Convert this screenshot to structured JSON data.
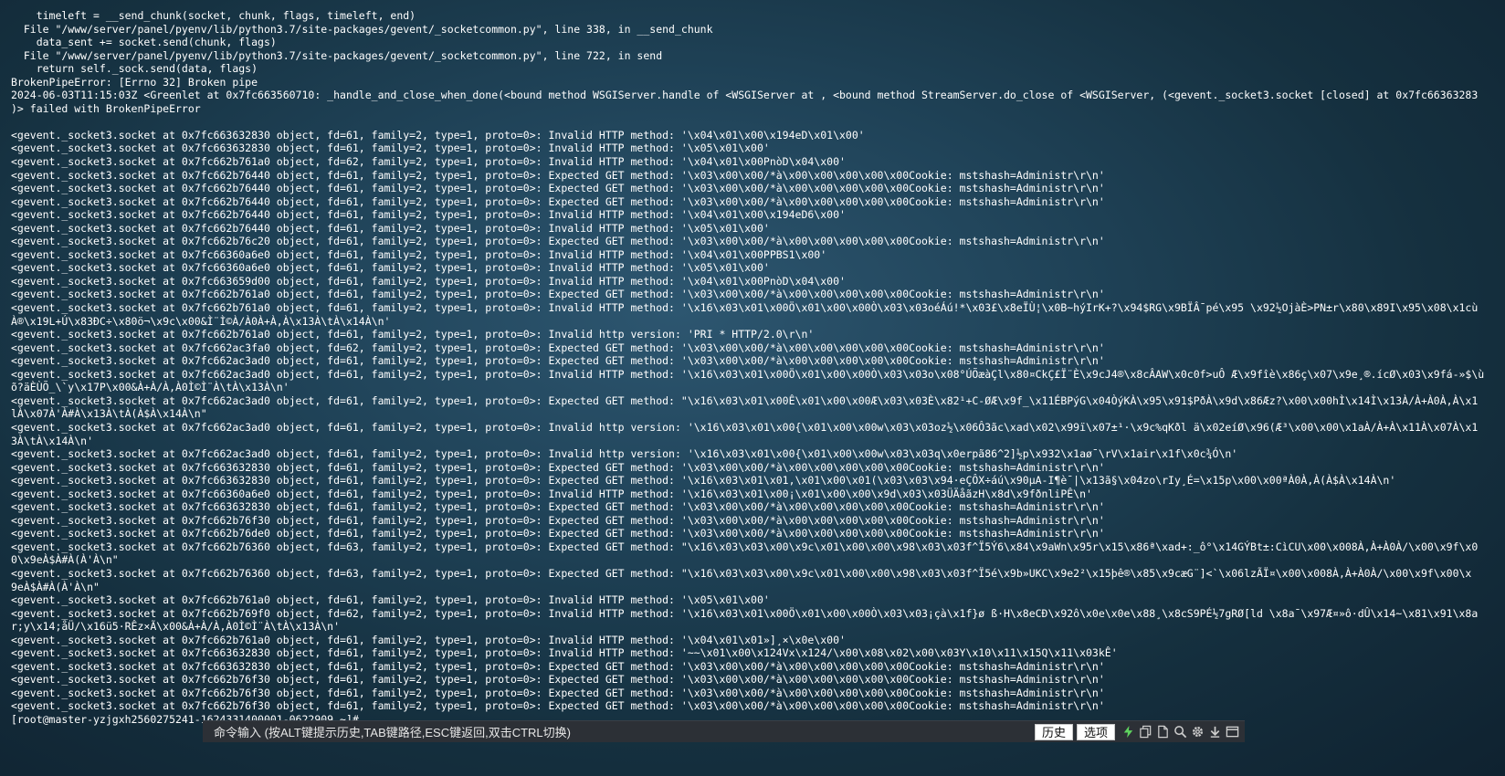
{
  "terminal": {
    "lines": [
      "    timeleft = __send_chunk(socket, chunk, flags, timeleft, end)",
      "  File \"/www/server/panel/pyenv/lib/python3.7/site-packages/gevent/_socketcommon.py\", line 338, in __send_chunk",
      "    data_sent += socket.send(chunk, flags)",
      "  File \"/www/server/panel/pyenv/lib/python3.7/site-packages/gevent/_socketcommon.py\", line 722, in send",
      "    return self._sock.send(data, flags)",
      "BrokenPipeError: [Errno 32] Broken pipe",
      "2024-06-03T11:15:03Z <Greenlet at 0x7fc663560710: _handle_and_close_when_done(<bound method WSGIServer.handle of <WSGIServer at , <bound method StreamServer.do_close of <WSGIServer, (<gevent._socket3.socket [closed] at 0x7fc66363283",
      ")> failed with BrokenPipeError",
      "",
      "<gevent._socket3.socket at 0x7fc663632830 object, fd=61, family=2, type=1, proto=0>: Invalid HTTP method: '\\x04\\x01\\x00\\x194eD\\x01\\x00'",
      "<gevent._socket3.socket at 0x7fc663632830 object, fd=61, family=2, type=1, proto=0>: Invalid HTTP method: '\\x05\\x01\\x00'",
      "<gevent._socket3.socket at 0x7fc662b761a0 object, fd=62, family=2, type=1, proto=0>: Invalid HTTP method: '\\x04\\x01\\x00PnòD\\x04\\x00'",
      "<gevent._socket3.socket at 0x7fc662b76440 object, fd=61, family=2, type=1, proto=0>: Expected GET method: '\\x03\\x00\\x00/*à\\x00\\x00\\x00\\x00\\x00Cookie: mstshash=Administr\\r\\n'",
      "<gevent._socket3.socket at 0x7fc662b76440 object, fd=61, family=2, type=1, proto=0>: Expected GET method: '\\x03\\x00\\x00/*à\\x00\\x00\\x00\\x00\\x00Cookie: mstshash=Administr\\r\\n'",
      "<gevent._socket3.socket at 0x7fc662b76440 object, fd=61, family=2, type=1, proto=0>: Expected GET method: '\\x03\\x00\\x00/*à\\x00\\x00\\x00\\x00\\x00Cookie: mstshash=Administr\\r\\n'",
      "<gevent._socket3.socket at 0x7fc662b76440 object, fd=61, family=2, type=1, proto=0>: Invalid HTTP method: '\\x04\\x01\\x00\\x194eD6\\x00'",
      "<gevent._socket3.socket at 0x7fc662b76440 object, fd=61, family=2, type=1, proto=0>: Invalid HTTP method: '\\x05\\x01\\x00'",
      "<gevent._socket3.socket at 0x7fc662b76c20 object, fd=61, family=2, type=1, proto=0>: Expected GET method: '\\x03\\x00\\x00/*à\\x00\\x00\\x00\\x00\\x00Cookie: mstshash=Administr\\r\\n'",
      "<gevent._socket3.socket at 0x7fc66360a6e0 object, fd=61, family=2, type=1, proto=0>: Invalid HTTP method: '\\x04\\x01\\x00PPBS1\\x00'",
      "<gevent._socket3.socket at 0x7fc66360a6e0 object, fd=61, family=2, type=1, proto=0>: Invalid HTTP method: '\\x05\\x01\\x00'",
      "<gevent._socket3.socket at 0x7fc663659d00 object, fd=61, family=2, type=1, proto=0>: Invalid HTTP method: '\\x04\\x01\\x00PnòD\\x04\\x00'",
      "<gevent._socket3.socket at 0x7fc662b761a0 object, fd=61, family=2, type=1, proto=0>: Expected GET method: '\\x03\\x00\\x00/*à\\x00\\x00\\x00\\x00\\x00Cookie: mstshash=Administr\\r\\n'",
      "<gevent._socket3.socket at 0x7fc662b761a0 object, fd=61, family=2, type=1, proto=0>: Invalid HTTP method: '\\x16\\x03\\x01\\x00Ö\\x01\\x00\\x00Ò\\x03\\x03oéÁú!*\\x03£\\x8eÏÙ¦\\x0B~hýIrK+?\\x94$RG\\x9BÏÂ¯pé\\x95 \\x92½OjàÈ>PN±r\\x80\\x89I\\x95\\x08\\x1cù",
      "À®\\x19L+Ú\\x83ÐC÷\\x80ö¬\\x9c\\x00&Ì¨Ì©À/À0À+À,À\\x13À\\tÀ\\x14À\\n'",
      "<gevent._socket3.socket at 0x7fc662b761a0 object, fd=61, family=2, type=1, proto=0>: Invalid http version: 'PRI * HTTP/2.0\\r\\n'",
      "<gevent._socket3.socket at 0x7fc662ac3fa0 object, fd=62, family=2, type=1, proto=0>: Expected GET method: '\\x03\\x00\\x00/*à\\x00\\x00\\x00\\x00\\x00Cookie: mstshash=Administr\\r\\n'",
      "<gevent._socket3.socket at 0x7fc662ac3ad0 object, fd=61, family=2, type=1, proto=0>: Expected GET method: '\\x03\\x00\\x00/*à\\x00\\x00\\x00\\x00\\x00Cookie: mstshash=Administr\\r\\n'",
      "<gevent._socket3.socket at 0x7fc662ac3ad0 object, fd=61, family=2, type=1, proto=0>: Invalid HTTP method: '\\x16\\x03\\x01\\x00Ö\\x01\\x00\\x00Ò\\x03\\x03o\\x08°ÚÕæàÇl\\x80¤CkÇ£Ï¨È\\x9cJ4®\\x8cÂAW\\x0c0f>uÔ Æ\\x9fîè\\x86ç\\x07\\x9e¸®.ícØ\\x03\\x9fá-»$\\ù",
      "õ?äÈÙÕ_\\`y\\x17P\\x00&À+À/À,À0Ì©Ì¨À\\tÀ\\x13À\\n'",
      "<gevent._socket3.socket at 0x7fc662ac3ad0 object, fd=61, family=2, type=1, proto=0>: Expected GET method: \"\\x16\\x03\\x01\\x00Ê\\x01\\x00\\x00Æ\\x03\\x03È\\x82¹+C-ØÆ\\x9f_\\x11ÉBPýG\\x04ÒýKÀ\\x95\\x91$PðÀ\\x9d\\x86Æz?\\x00\\x00hÌ\\x14Ì\\x13À/À+À0À,À\\x1",
      "lÀ\\x07À'À#À\\x13À\\tÀ(À$À\\x14À\\n\"",
      "<gevent._socket3.socket at 0x7fc662ac3ad0 object, fd=61, family=2, type=1, proto=0>: Invalid http version: '\\x16\\x03\\x01\\x00{\\x01\\x00\\x00w\\x03\\x03oz½\\x06Ô3ãc\\xad\\x02\\x99ï\\x07±¹·\\x9c%qKðl ä\\x02eíØ\\x96(Æ³\\x00\\x00\\x1aÀ/À+À\\x11À\\x07À\\x1",
      "3À\\tÀ\\x14À\\n'",
      "<gevent._socket3.socket at 0x7fc662ac3ad0 object, fd=61, family=2, type=1, proto=0>: Invalid http version: '\\x16\\x03\\x01\\x00{\\x01\\x00\\x00w\\x03\\x03q\\x0erpã86^2]½p\\x932\\x1aø¯\\rV\\x1air\\x1f\\x0c¾Ó\\n'",
      "<gevent._socket3.socket at 0x7fc663632830 object, fd=61, family=2, type=1, proto=0>: Expected GET method: '\\x03\\x00\\x00/*à\\x00\\x00\\x00\\x00\\x00Cookie: mstshash=Administr\\r\\n'",
      "<gevent._socket3.socket at 0x7fc663632830 object, fd=61, family=2, type=1, proto=0>: Expected GET method: '\\x16\\x03\\x01\\x01,\\x01\\x00\\x01(\\x03\\x03\\x94·eÇÔX÷áú\\x90µA-I¶è¯|\\x13ã§\\x04zo\\rIy¸É=\\x15p\\x00\\x00ªÀ0À,À(À$À\\x14À\\n'",
      "<gevent._socket3.socket at 0x7fc66360a6e0 object, fd=61, family=2, type=1, proto=0>: Invalid HTTP method: '\\x16\\x03\\x01\\x00¡\\x01\\x00\\x00\\x9d\\x03\\x03ÜÄåãzH\\x8d\\x9fðnliPÊ\\n'",
      "<gevent._socket3.socket at 0x7fc663632830 object, fd=61, family=2, type=1, proto=0>: Expected GET method: '\\x03\\x00\\x00/*à\\x00\\x00\\x00\\x00\\x00Cookie: mstshash=Administr\\r\\n'",
      "<gevent._socket3.socket at 0x7fc662b76f30 object, fd=61, family=2, type=1, proto=0>: Expected GET method: '\\x03\\x00\\x00/*à\\x00\\x00\\x00\\x00\\x00Cookie: mstshash=Administr\\r\\n'",
      "<gevent._socket3.socket at 0x7fc662b76de0 object, fd=61, family=2, type=1, proto=0>: Expected GET method: '\\x03\\x00\\x00/*à\\x00\\x00\\x00\\x00\\x00Cookie: mstshash=Administr\\r\\n'",
      "<gevent._socket3.socket at 0x7fc662b76360 object, fd=63, family=2, type=1, proto=0>: Expected GET method: \"\\x16\\x03\\x03\\x00\\x9c\\x01\\x00\\x00\\x98\\x03\\x03f^Ï5Ý6\\x84\\x9aWn\\x95r\\x15\\x86ª\\xad+:_ô°\\x14GÝBt±:CìCU\\x00\\x008À,À+À0À/\\x00\\x9f\\x0",
      "0\\x9eÀ$À#À(À'À\\n\"",
      "<gevent._socket3.socket at 0x7fc662b76360 object, fd=63, family=2, type=1, proto=0>: Expected GET method: \"\\x16\\x03\\x03\\x00\\x9c\\x01\\x00\\x00\\x98\\x03\\x03f^Ï5é\\x9b»UKC\\x9e2²\\x15þê®\\x85\\x9cæG¨]<`\\x06lzÃÏ¤\\x00\\x008À,À+À0À/\\x00\\x9f\\x00\\x",
      "9eÀ$À#À(À'À\\n\"",
      "<gevent._socket3.socket at 0x7fc662b761a0 object, fd=61, family=2, type=1, proto=0>: Invalid HTTP method: '\\x05\\x01\\x00'",
      "<gevent._socket3.socket at 0x7fc662b769f0 object, fd=62, family=2, type=1, proto=0>: Invalid HTTP method: '\\x16\\x03\\x01\\x00Ö\\x01\\x00\\x00Ò\\x03\\x03¡çà\\x1f}ø ß·H\\x8eCÐ\\x92ô\\x0e\\x0e\\x88¸\\x8cS9PÉ½7gRØ[ld \\x8a¯\\x97Æ¤»ô·dÛ\\x14~\\x81\\x91\\x8a",
      "r;y\\x14;åÜ/\\x16ü5·RÊz×Ã\\x00&À+À/À,À0Ì©Ì¨À\\tÀ\\x13À\\n'",
      "<gevent._socket3.socket at 0x7fc662b761a0 object, fd=61, family=2, type=1, proto=0>: Invalid HTTP method: '\\x04\\x01\\x01»]¸×\\x0e\\x00'",
      "<gevent._socket3.socket at 0x7fc663632830 object, fd=61, family=2, type=1, proto=0>: Invalid HTTP method: '~~\\x01\\x00\\x124Vx\\x124/\\x00\\x08\\x02\\x00\\x03Y\\x10\\x11\\x15Q\\x11\\x03kÊ'",
      "<gevent._socket3.socket at 0x7fc663632830 object, fd=61, family=2, type=1, proto=0>: Expected GET method: '\\x03\\x00\\x00/*à\\x00\\x00\\x00\\x00\\x00Cookie: mstshash=Administr\\r\\n'",
      "<gevent._socket3.socket at 0x7fc662b76f30 object, fd=61, family=2, type=1, proto=0>: Expected GET method: '\\x03\\x00\\x00/*à\\x00\\x00\\x00\\x00\\x00Cookie: mstshash=Administr\\r\\n'",
      "<gevent._socket3.socket at 0x7fc662b76f30 object, fd=61, family=2, type=1, proto=0>: Expected GET method: '\\x03\\x00\\x00/*à\\x00\\x00\\x00\\x00\\x00Cookie: mstshash=Administr\\r\\n'",
      "<gevent._socket3.socket at 0x7fc662b76f30 object, fd=61, family=2, type=1, proto=0>: Expected GET method: '\\x03\\x00\\x00/*à\\x00\\x00\\x00\\x00\\x00Cookie: mstshash=Administr\\r\\n'"
    ],
    "prompt": "[root@master-yzjgxh2560275241-1624331400001-0622909 ~]# "
  },
  "command_bar": {
    "hint": "命令输入 (按ALT键提示历史,TAB键路径,ESC键返回,双击CTRL切换)",
    "history_button": "历史",
    "options_button": "选项",
    "icons": [
      "lightning-icon",
      "copy-icon",
      "document-icon",
      "search-icon",
      "gear-icon",
      "download-icon",
      "window-icon"
    ]
  },
  "colors": {
    "text": "#ffffff",
    "accent_green": "#5fd35f"
  }
}
